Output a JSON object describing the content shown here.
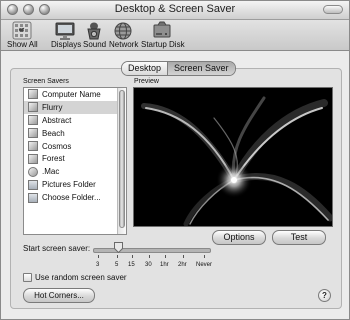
{
  "window": {
    "title": "Desktop & Screen Saver"
  },
  "toolbar": {
    "items": [
      {
        "label": "Show All",
        "icon": "apple-grid-icon"
      },
      {
        "label": "Displays",
        "icon": "display-icon"
      },
      {
        "label": "Sound",
        "icon": "speaker-icon"
      },
      {
        "label": "Network",
        "icon": "network-globe-icon"
      },
      {
        "label": "Startup Disk",
        "icon": "hard-disk-icon"
      }
    ]
  },
  "tabs": [
    {
      "label": "Desktop",
      "selected": false
    },
    {
      "label": "Screen Saver",
      "selected": true
    }
  ],
  "screen_savers": {
    "heading": "Screen Savers",
    "items": [
      {
        "label": "Computer Name",
        "icon": "screensaver-icon",
        "selected": false
      },
      {
        "label": "Flurry",
        "icon": "screensaver-icon",
        "selected": true
      },
      {
        "label": "Abstract",
        "icon": "screensaver-icon",
        "selected": false
      },
      {
        "label": "Beach",
        "icon": "screensaver-icon",
        "selected": false
      },
      {
        "label": "Cosmos",
        "icon": "screensaver-icon",
        "selected": false
      },
      {
        "label": "Forest",
        "icon": "screensaver-icon",
        "selected": false
      },
      {
        "label": ".Mac",
        "icon": "mac-icon",
        "selected": false
      },
      {
        "label": "Pictures Folder",
        "icon": "folder-icon",
        "selected": false
      },
      {
        "label": "Choose Folder...",
        "icon": "folder-icon",
        "selected": false
      }
    ]
  },
  "preview": {
    "heading": "Preview"
  },
  "buttons": {
    "options": "Options",
    "test": "Test",
    "hot_corners": "Hot Corners..."
  },
  "start_screen_saver": {
    "label": "Start screen saver:",
    "selected_value": "5",
    "tick_labels": [
      "3",
      "5",
      "15",
      "30",
      "1hr",
      "2hr",
      "Never"
    ]
  },
  "random_saver": {
    "label": "Use random screen saver",
    "checked": false
  },
  "help": {
    "label": "?"
  }
}
